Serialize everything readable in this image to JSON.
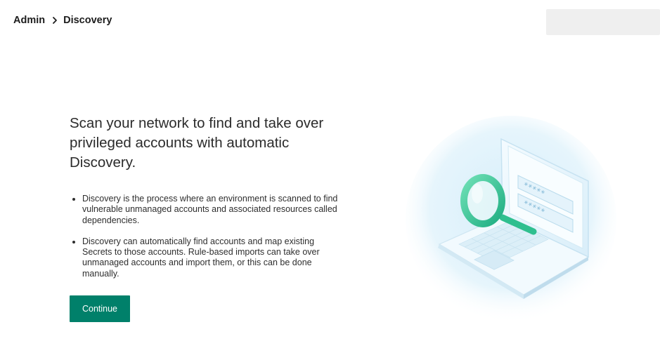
{
  "breadcrumb": {
    "parent": "Admin",
    "current": "Discovery",
    "separator_icon": "chevron-right-icon"
  },
  "main": {
    "headline": "Scan your network to find and take over privileged accounts with automatic Discovery.",
    "bullets": [
      "Discovery is the process where an environment is scanned to find vulnerable unmanaged accounts and associated resources called dependencies.",
      "Discovery can automatically find accounts and map existing Secrets to those accounts. Rule-based imports can take over unmanaged accounts and import them, or this can be done manually."
    ],
    "continue_label": "Continue"
  },
  "illustration": {
    "icon": "laptop-magnifying-glass-illustration",
    "password_mask_1": "*****",
    "password_mask_2": "*****"
  },
  "colors": {
    "accent": "#00806a",
    "illustration_bg": "#e3f3fb",
    "magnifier": "#3fc99a"
  }
}
